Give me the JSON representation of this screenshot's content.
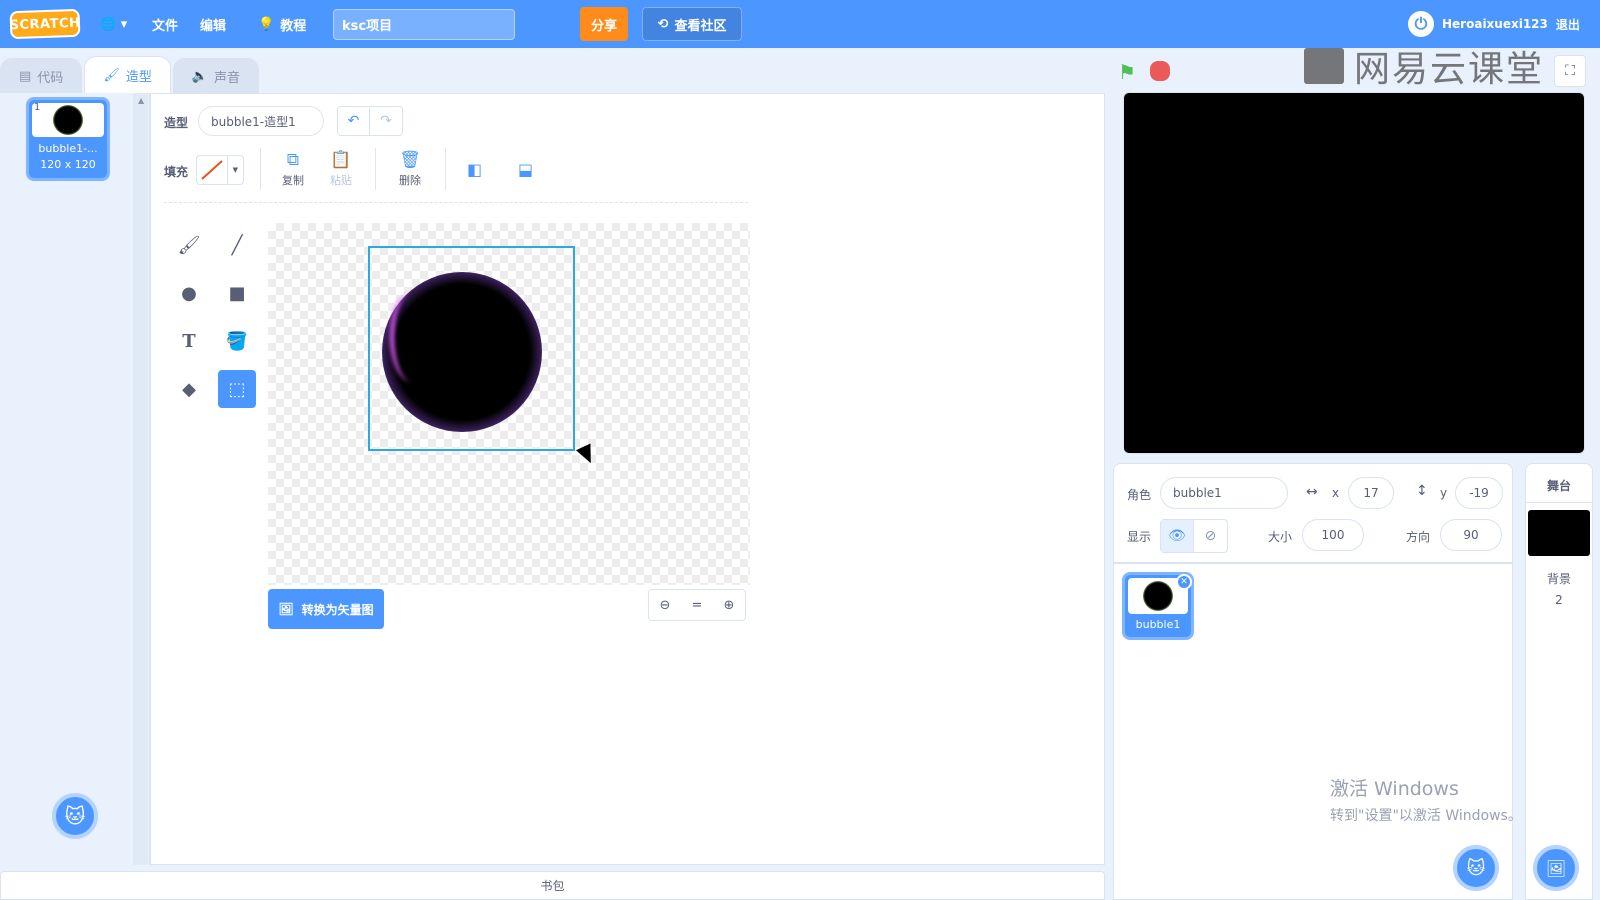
{
  "menubar": {
    "logo": "SCRATCH",
    "file": "文件",
    "edit": "编辑",
    "tutorial": "教程",
    "project_title": "ksc项目",
    "share": "分享",
    "community": "查看社区",
    "username": "Heroaixuexi123",
    "logout": "退出"
  },
  "tabs": [
    {
      "label": "代码",
      "icon": "code-icon"
    },
    {
      "label": "造型",
      "icon": "brush-icon"
    },
    {
      "label": "声音",
      "icon": "speaker-icon"
    }
  ],
  "costumes": [
    {
      "number": "1",
      "name": "bubble1-...",
      "size": "120 x 120"
    }
  ],
  "paint": {
    "costume_label": "造型",
    "costume_name": "bubble1-造型1",
    "fill_label": "填充",
    "copy": "复制",
    "paste": "粘贴",
    "delete": "删除",
    "convert": "转换为矢量图",
    "zoom_reset": "="
  },
  "backpack": "书包",
  "watermark": "网易云课堂",
  "sprite": {
    "label": "角色",
    "name": "bubble1",
    "x_label": "x",
    "x": "17",
    "y_label": "y",
    "y": "-19",
    "show_label": "显示",
    "size_label": "大小",
    "size": "100",
    "direction_label": "方向",
    "direction": "90"
  },
  "sprites": [
    {
      "name": "bubble1"
    }
  ],
  "stage_panel": {
    "title": "舞台",
    "backdrops_label": "背景",
    "backdrops_count": "2"
  },
  "windows": {
    "line1": "激活 Windows",
    "line2": "转到\"设置\"以激活 Windows。"
  },
  "colors": {
    "accent": "#4c97ff",
    "share": "#ff8c1a",
    "flag": "#4cbf56",
    "stop": "#ec5959"
  }
}
